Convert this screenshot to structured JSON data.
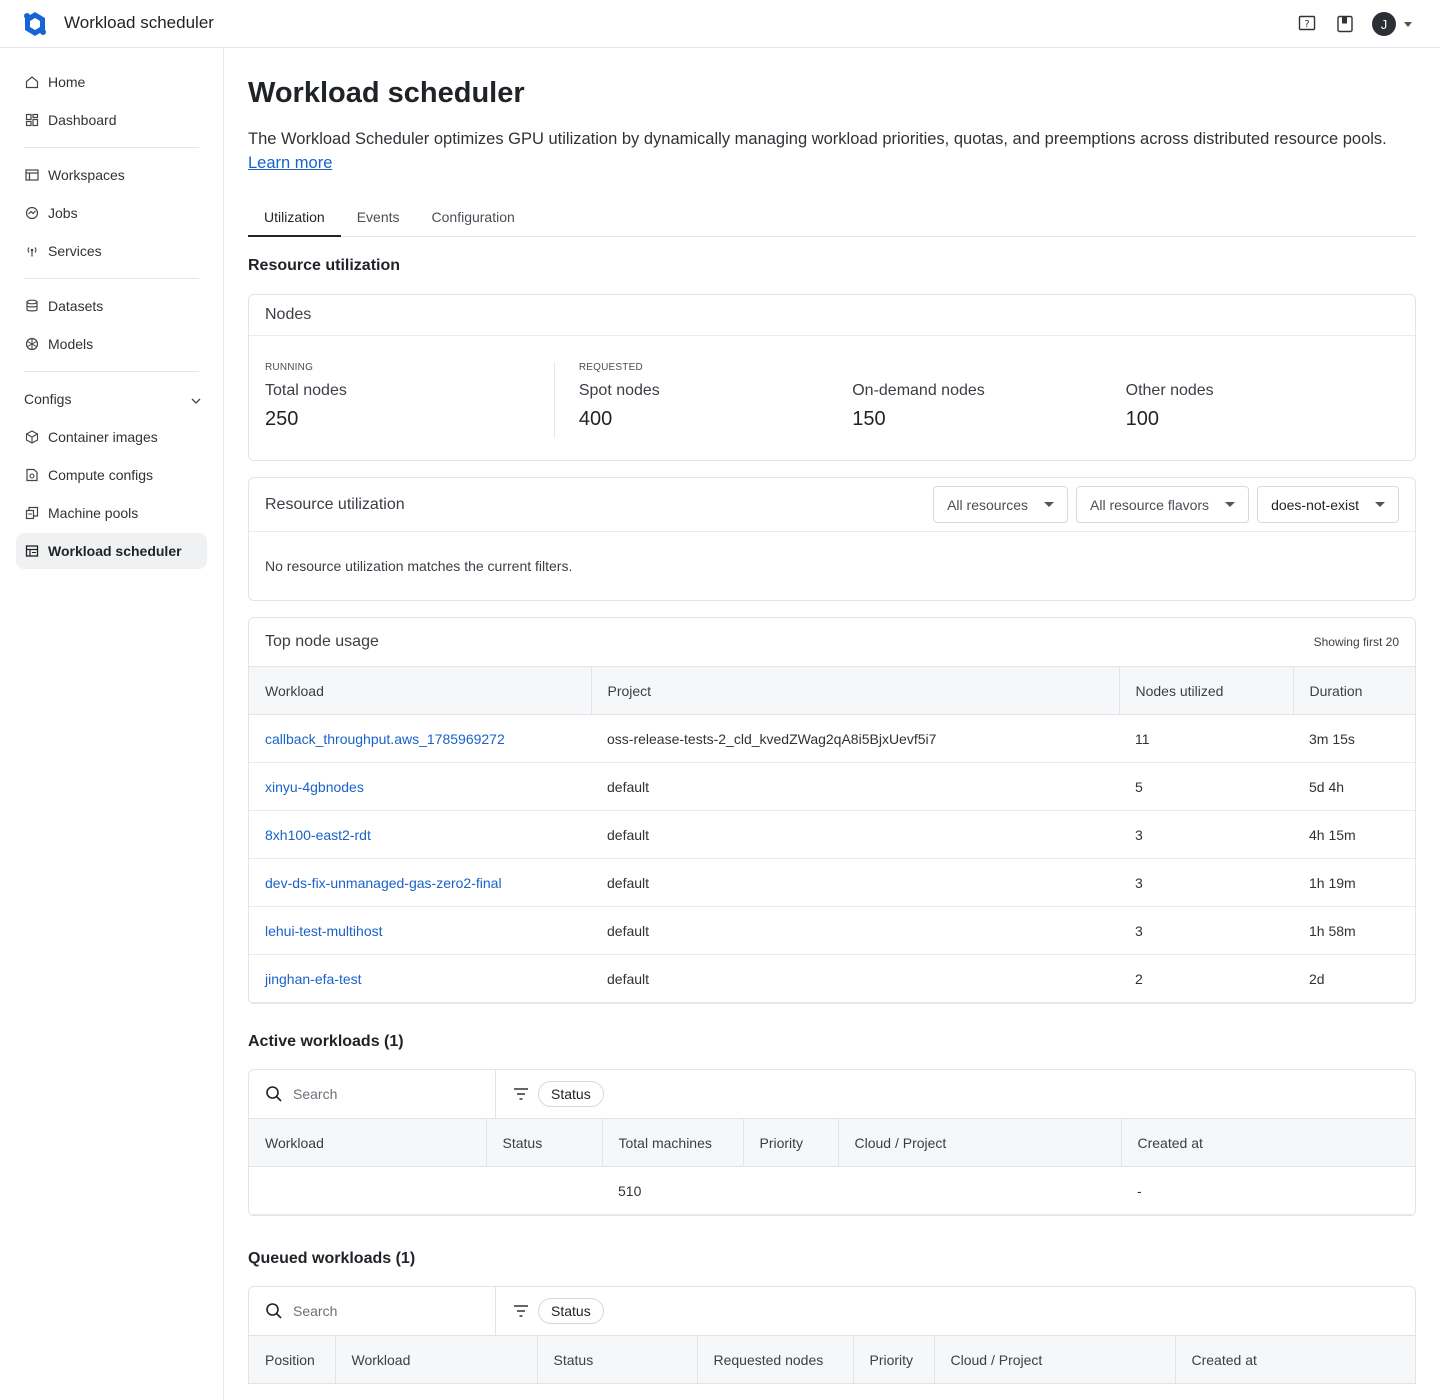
{
  "app": {
    "title": "Workload scheduler",
    "avatar_initial": "J"
  },
  "icons": {
    "logo": "logo-icon",
    "help": "help-icon",
    "docs": "book-icon",
    "avatar_caret": "chevron-down-icon"
  },
  "sidebar": {
    "items": [
      {
        "label": "Home",
        "icon": "home-icon"
      },
      {
        "label": "Dashboard",
        "icon": "dashboard-icon"
      },
      {
        "label": "Workspaces",
        "icon": "workspaces-icon"
      },
      {
        "label": "Jobs",
        "icon": "jobs-icon"
      },
      {
        "label": "Services",
        "icon": "services-icon"
      },
      {
        "label": "Datasets",
        "icon": "database-icon"
      },
      {
        "label": "Models",
        "icon": "models-icon"
      },
      {
        "label": "Container images",
        "icon": "cube-icon"
      },
      {
        "label": "Compute configs",
        "icon": "compute-config-icon"
      },
      {
        "label": "Machine pools",
        "icon": "machine-pools-icon"
      },
      {
        "label": "Workload scheduler",
        "icon": "scheduler-icon"
      }
    ],
    "section_configs": "Configs"
  },
  "page": {
    "title": "Workload scheduler",
    "description": "The Workload Scheduler optimizes GPU utilization by dynamically managing workload priorities, quotas, and preemptions across distributed resource pools.",
    "learn_more": "Learn more",
    "tabs": [
      "Utilization",
      "Events",
      "Configuration"
    ],
    "active_tab": "Utilization"
  },
  "resource_utilization_title": "Resource utilization",
  "nodes": {
    "title": "Nodes",
    "running_caption": "RUNNING",
    "requested_caption": "REQUESTED",
    "total_label": "Total nodes",
    "total_value": "250",
    "spot_label": "Spot nodes",
    "spot_value": "400",
    "ondemand_label": "On-demand nodes",
    "ondemand_value": "150",
    "other_label": "Other nodes",
    "other_value": "100"
  },
  "resource_card": {
    "title": "Resource utilization",
    "select_resources": "All resources",
    "select_flavors": "All resource flavors",
    "select_third": "does-not-exist",
    "empty": "No resource utilization matches the current filters."
  },
  "top_nodes": {
    "title": "Top node usage",
    "note": "Showing first 20",
    "columns": [
      "Workload",
      "Project",
      "Nodes utilized",
      "Duration"
    ],
    "rows": [
      [
        "callback_throughput.aws_1785969272",
        "oss-release-tests-2_cld_kvedZWag2qA8i5BjxUevf5i7",
        "11",
        "3m 15s"
      ],
      [
        "xinyu-4gbnodes",
        "default",
        "5",
        "5d 4h"
      ],
      [
        "8xh100-east2-rdt",
        "default",
        "3",
        "4h 15m"
      ],
      [
        "dev-ds-fix-unmanaged-gas-zero2-final",
        "default",
        "3",
        "1h 19m"
      ],
      [
        "lehui-test-multihost",
        "default",
        "3",
        "1h 58m"
      ],
      [
        "jinghan-efa-test",
        "default",
        "2",
        "2d"
      ]
    ]
  },
  "active": {
    "title": "Active workloads (1)",
    "search_placeholder": "Search",
    "status_chip": "Status",
    "columns": [
      "Workload",
      "Status",
      "Total machines",
      "Priority",
      "Cloud / Project",
      "Created at"
    ],
    "rows": [
      [
        "",
        "",
        "510",
        "",
        "",
        "-"
      ]
    ]
  },
  "queued": {
    "title": "Queued workloads (1)",
    "search_placeholder": "Search",
    "status_chip": "Status",
    "columns": [
      "Position",
      "Workload",
      "Status",
      "Requested nodes",
      "Priority",
      "Cloud / Project",
      "Created at"
    ]
  }
}
